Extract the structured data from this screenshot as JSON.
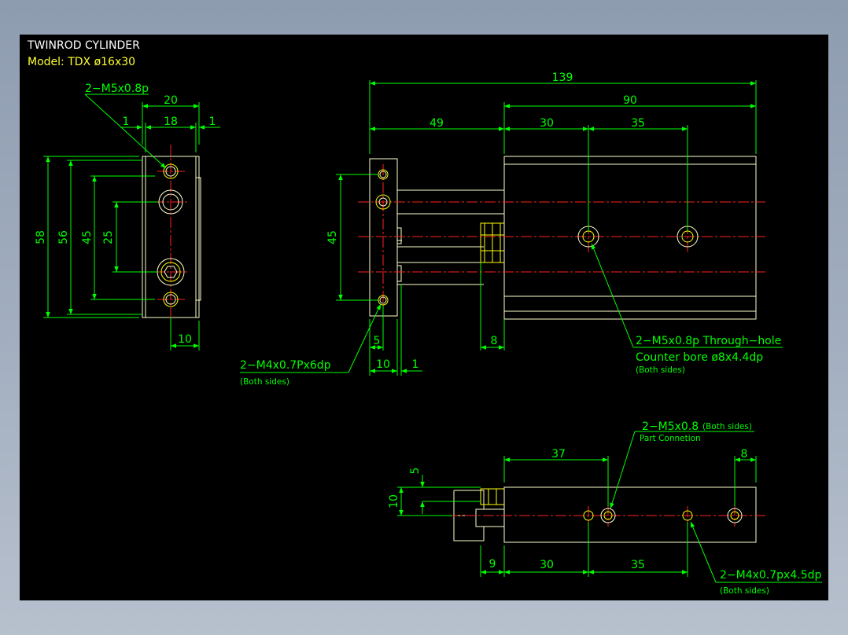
{
  "title_block": {
    "title": "TWINROD CYLINDER",
    "model": "Model: TDX ø16x30"
  },
  "colors": {
    "viewport_bg": "#000000",
    "dimension": "#00ff00",
    "object": "#ffffcc",
    "centerline": "#ff2020",
    "hole": "#ffff00",
    "title": "#ffffff",
    "model": "#ffff33"
  },
  "left_view": {
    "dims": {
      "width_20": "20",
      "width_18": "18",
      "gap_left_1": "1",
      "gap_right_1": "1",
      "height_58": "58",
      "height_56": "56",
      "height_45": "45",
      "height_25": "25",
      "offset_10": "10"
    },
    "callout_thread": "2−M5x0.8p"
  },
  "front_view": {
    "dims": {
      "total_139": "139",
      "body_90": "90",
      "rod_49": "49",
      "hole_30": "30",
      "hole_35": "35",
      "plate_45": "45",
      "plate_5": "5",
      "plate_10": "10",
      "gap_1": "1",
      "nut_8": "8"
    },
    "callout_plate": "2−M4x0.7Px6dp",
    "callout_plate_note": "(Both sides)",
    "callout_through_1": "2−M5x0.8p Through−hole",
    "callout_through_2": "Counter bore ø8x4.4dp",
    "callout_through_note": "(Both sides)"
  },
  "bottom_view": {
    "dims": {
      "port_37": "37",
      "end_8": "8",
      "height_5": "5",
      "height_10": "10",
      "offset_9": "9",
      "hole_30": "30",
      "hole_35": "35"
    },
    "callout_port": "2−M5x0.8",
    "callout_port_note": "(Both sides)",
    "callout_port_sub": "Part Connetion",
    "callout_tap": "2−M4x0.7px4.5dp",
    "callout_tap_note": "(Both sides)"
  }
}
